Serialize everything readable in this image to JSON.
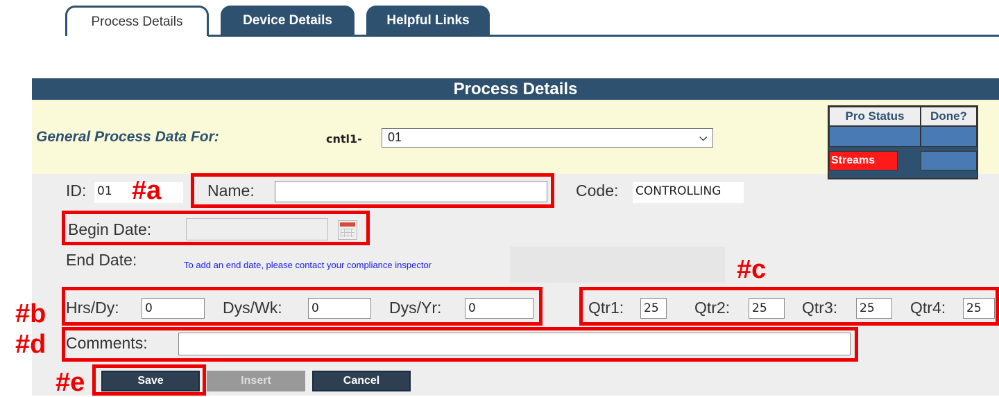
{
  "tabs": [
    {
      "label": "Process Details",
      "active": true
    },
    {
      "label": "Device Details",
      "active": false
    },
    {
      "label": "Helpful Links",
      "active": false
    }
  ],
  "panel": {
    "title": "Process Details",
    "general_label": "General Process Data For:",
    "cntl_label": "cntl1-",
    "selected_process": "01"
  },
  "status_table": {
    "col1": "Pro Status",
    "col2": "Done?",
    "rows": [
      "",
      "Streams"
    ]
  },
  "fields": {
    "id_label": "ID:",
    "id_value": "01",
    "name_label": "Name:",
    "name_value": "",
    "code_label": "Code:",
    "code_value": "CONTROLLING",
    "begin_label": "Begin Date:",
    "begin_value": "",
    "end_label": "End Date:",
    "end_note": "To add an end date, please contact your compliance inspector",
    "hrs_label": "Hrs/Dy:",
    "hrs_value": "0",
    "dwk_label": "Dys/Wk:",
    "dwk_value": "0",
    "dyr_label": "Dys/Yr:",
    "dyr_value": "0",
    "q1_label": "Qtr1:",
    "q1_value": "25",
    "q2_label": "Qtr2:",
    "q2_value": "25",
    "q3_label": "Qtr3:",
    "q3_value": "25",
    "q4_label": "Qtr4:",
    "q4_value": "25",
    "comments_label": "Comments:",
    "comments_value": ""
  },
  "buttons": {
    "save": "Save",
    "insert": "Insert",
    "cancel": "Cancel"
  },
  "annotations": {
    "a": "#a",
    "b": "#b",
    "c": "#c",
    "d": "#d",
    "e": "#e"
  },
  "colors": {
    "brand_blue": "#2e5170",
    "annotation_red": "#ee0000",
    "status_red": "#ff1a1a"
  }
}
